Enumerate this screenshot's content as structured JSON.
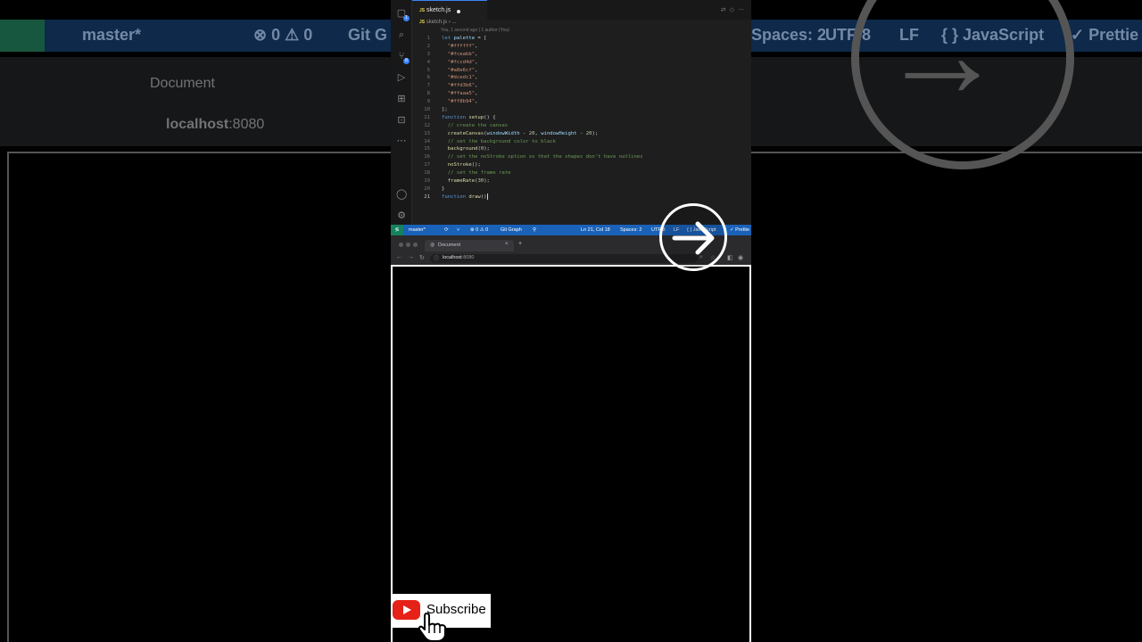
{
  "background": {
    "branch": "master*",
    "problems": "⊗ 0 ⚠ 0",
    "git": "Git G",
    "spaces": "Spaces: 2",
    "encoding": "UTF-8",
    "eol": "LF",
    "language": "{ } JavaScript",
    "prettier": "✓ Prettie",
    "tab_title": "Document",
    "url_host": "localhost",
    "url_port": ":8080"
  },
  "editor": {
    "tab_label": "sketch.js",
    "breadcrumb_file": "sketch.js",
    "breadcrumb_rest": "› ...",
    "blame": "You, 1 second ago | 1 author (You)",
    "lines": [
      {
        "n": "1",
        "html": "<span class='kw'>let</span> <span class='vr'>palette</span> = ["
      },
      {
        "n": "2",
        "html": "  <span class='str'>\"#ffffff\"</span>,"
      },
      {
        "n": "3",
        "html": "  <span class='str'>\"#fceabb\"</span>,"
      },
      {
        "n": "4",
        "html": "  <span class='str'>\"#fccd4d\"</span>,"
      },
      {
        "n": "5",
        "html": "  <span class='str'>\"#a8e6cf\"</span>,"
      },
      {
        "n": "6",
        "html": "  <span class='str'>\"#dcedc1\"</span>,"
      },
      {
        "n": "7",
        "html": "  <span class='str'>\"#ffd3b6\"</span>,"
      },
      {
        "n": "8",
        "html": "  <span class='str'>\"#ffaaa5\"</span>,"
      },
      {
        "n": "9",
        "html": "  <span class='str'>\"#ff8b94\"</span>,"
      },
      {
        "n": "10",
        "html": "];"
      },
      {
        "n": "11",
        "html": "<span class='kw'>function</span> <span class='fn'>setup</span>() {"
      },
      {
        "n": "12",
        "html": "  <span class='cm'>// create the canvas</span>"
      },
      {
        "n": "13",
        "html": "  <span class='fn'>createCanvas</span>(<span class='vr'>windowWidth</span> - <span class='nm'>20</span>, <span class='vr'>windowHeight</span> - <span class='nm'>20</span>);"
      },
      {
        "n": "14",
        "html": "  <span class='cm'>// set the background color to black</span>"
      },
      {
        "n": "15",
        "html": "  <span class='fn'>background</span>(<span class='nm'>0</span>);"
      },
      {
        "n": "16",
        "html": "  <span class='cm'>// set the noStroke option so that the shapes don't have outlines</span>"
      },
      {
        "n": "17",
        "html": "  <span class='fn'>noStroke</span>();"
      },
      {
        "n": "18",
        "html": "  <span class='cm'>// set the frame rate</span>"
      },
      {
        "n": "19",
        "html": "  <span class='fn'>frameRate</span>(<span class='nm'>30</span>);"
      },
      {
        "n": "20",
        "html": "}"
      },
      {
        "n": "21",
        "html": "<span class='kw'>function</span> <span class='fn'>draw</span>()<span class='cursor'></span>"
      }
    ]
  },
  "statusbar": {
    "branch": "master*",
    "problems": "⊗ 0 ⚠ 0",
    "git_graph": "Git Graph",
    "position": "Ln 21, Col 18",
    "spaces": "Spaces: 2",
    "encoding": "UTF-8",
    "eol": "LF",
    "language": "{ } JavaScript",
    "prettier": "✓ Prettie"
  },
  "browser": {
    "tab_title": "Document",
    "close": "×",
    "new_tab": "+",
    "url_host": "localhost",
    "url_port": ":8080"
  },
  "subscribe": {
    "label": "Subscribe"
  },
  "colors": {
    "status_bar": "#1a62b8",
    "remote": "#16825d",
    "youtube_red": "#e62117"
  }
}
